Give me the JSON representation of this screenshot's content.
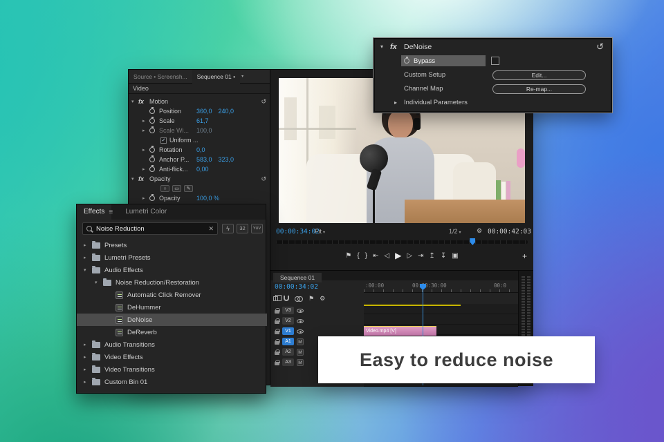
{
  "icons": {
    "chevron_collapsed": "▸",
    "chevron_expanded": "▾",
    "caret_down": "▾",
    "clear": "✕",
    "check": "✓",
    "reset": "↺",
    "fx_badge": "fx",
    "menu": "≡",
    "wrench": "⚙",
    "ellipse": "○",
    "rect": "▭",
    "pen": "✎",
    "marker": "⚑",
    "mark_in": "{",
    "mark_out": "}",
    "go_to_in": "⇤",
    "step_back": "◁",
    "play": "▶",
    "step_forward": "▷",
    "go_to_out": "⇥",
    "lift": "↥",
    "extract": "↧",
    "export_frame": "▣",
    "add": "+",
    "lightning": "ϟ"
  },
  "colors": {
    "accent_blue": "#3aa0e8",
    "track_badge_blue": "#2d7dd2",
    "clip_video_pink": "#d78ab8",
    "clip_audio_blue": "#5f5fc9",
    "render_bar_yellow": "#c7b500",
    "selection_gray": "#4c4c4c",
    "banner_bg": "#ffffff",
    "banner_text": "#3d3d3d"
  },
  "banner": {
    "text": "Easy to reduce noise"
  },
  "denoise_panel": {
    "title": "DeNoise",
    "bypass_label": "Bypass",
    "custom_setup_label": "Custom Setup",
    "edit_button": "Edit...",
    "channel_map_label": "Channel Map",
    "remap_button": "Re-map...",
    "individual_parameters_label": "Individual Parameters"
  },
  "effects_panel": {
    "tab_effects": "Effects",
    "tab_lumetri": "Lumetri Color",
    "search_value": "Noise Reduction",
    "badge_32": "32",
    "badge_yuv": "YUV",
    "tree": [
      {
        "label": "Presets"
      },
      {
        "label": "Lumetri Presets"
      },
      {
        "label": "Audio Effects"
      },
      {
        "label": "Noise Reduction/Restoration"
      },
      {
        "label": "Automatic Click Remover"
      },
      {
        "label": "DeHummer"
      },
      {
        "label": "DeNoise"
      },
      {
        "label": "DeReverb"
      },
      {
        "label": "Audio Transitions"
      },
      {
        "label": "Video Effects"
      },
      {
        "label": "Video Transitions"
      },
      {
        "label": "Custom Bin 01"
      }
    ]
  },
  "effect_controls": {
    "tab_source": "Source • Screensh...",
    "tab_sequence": "Sequence 01 •",
    "section_video": "Video",
    "motion_label": "Motion",
    "opacity_group_label": "Opacity",
    "rows": {
      "position": {
        "label": "Position",
        "x": "360,0",
        "y": "240,0"
      },
      "scale": {
        "label": "Scale",
        "value": "61,7"
      },
      "scale_width": {
        "label": "Scale Wi...",
        "value": "100,0"
      },
      "uniform": {
        "label": "Uniform ..."
      },
      "rotation": {
        "label": "Rotation",
        "value": "0,0"
      },
      "anchor": {
        "label": "Anchor P...",
        "x": "583,0",
        "y": "323,0"
      },
      "antiflicker": {
        "label": "Anti-flick...",
        "value": "0,00"
      },
      "opacity": {
        "label": "Opacity",
        "value": "100,0 %"
      }
    }
  },
  "program_monitor": {
    "timecode_left": "00:00:34:02",
    "zoom_select": "Fit",
    "resolution_select": "1/2",
    "timecode_right": "00:00:42:03"
  },
  "timeline": {
    "tab": "Sequence 01",
    "timecode": "00:00:34:02",
    "ruler_labels": [
      ":00:00",
      "00:00:30:00",
      "00:0"
    ],
    "video_tracks": [
      "V3",
      "V2",
      "V1"
    ],
    "audio_tracks": [
      "A1",
      "A2",
      "A3"
    ],
    "mute_label": "M",
    "clip_label": "Video.mp4 [V]"
  }
}
